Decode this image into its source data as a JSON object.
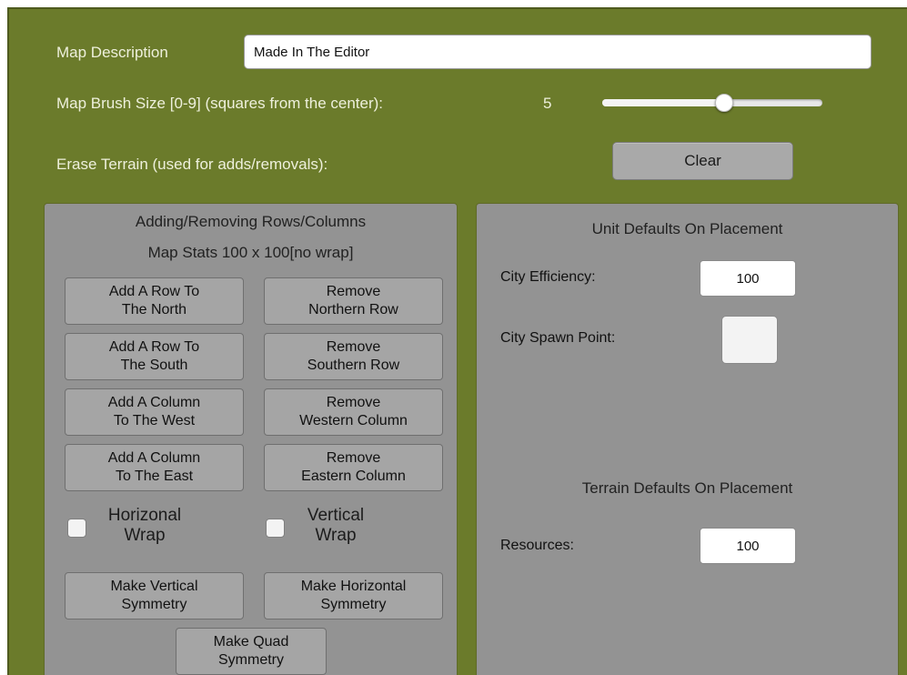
{
  "map_description": {
    "label": "Map Description",
    "value": "Made In The Editor"
  },
  "brush": {
    "label": "Map Brush Size [0-9] (squares from the center):",
    "value": "5",
    "level": 0.5556
  },
  "erase": {
    "label": "Erase Terrain (used for adds/removals):",
    "button": "Clear"
  },
  "rows_panel": {
    "title": "Adding/Removing Rows/Columns",
    "stats": "Map Stats 100 x 100[no wrap]",
    "buttons": {
      "add_north": "Add A Row To\nThe North",
      "remove_north": "Remove\nNorthern Row",
      "add_south": "Add A Row To\nThe South",
      "remove_south": "Remove\nSouthern Row",
      "add_west": "Add A Column\nTo The West",
      "remove_west": "Remove\nWestern Column",
      "add_east": "Add A Column\nTo The East",
      "remove_east": "Remove\nEastern Column",
      "vertical_symmetry": "Make Vertical\nSymmetry",
      "horizontal_symmetry": "Make Horizontal\nSymmetry",
      "quad_symmetry": "Make Quad\nSymmetry"
    },
    "horizontal_wrap": {
      "label": "Horizonal\nWrap",
      "checked": false
    },
    "vertical_wrap": {
      "label": "Vertical\nWrap",
      "checked": false
    }
  },
  "unit_panel": {
    "title": "Unit Defaults On Placement",
    "city_efficiency": {
      "label": "City Efficiency:",
      "value": "100"
    },
    "city_spawn_point": {
      "label": "City Spawn Point:",
      "checked": false
    },
    "terrain_title": "Terrain Defaults On Placement",
    "resources": {
      "label": "Resources:",
      "value": "100"
    }
  },
  "colors": {
    "background": "#6b7b2b",
    "panel": "#939393",
    "button": "#a5a5a5"
  }
}
